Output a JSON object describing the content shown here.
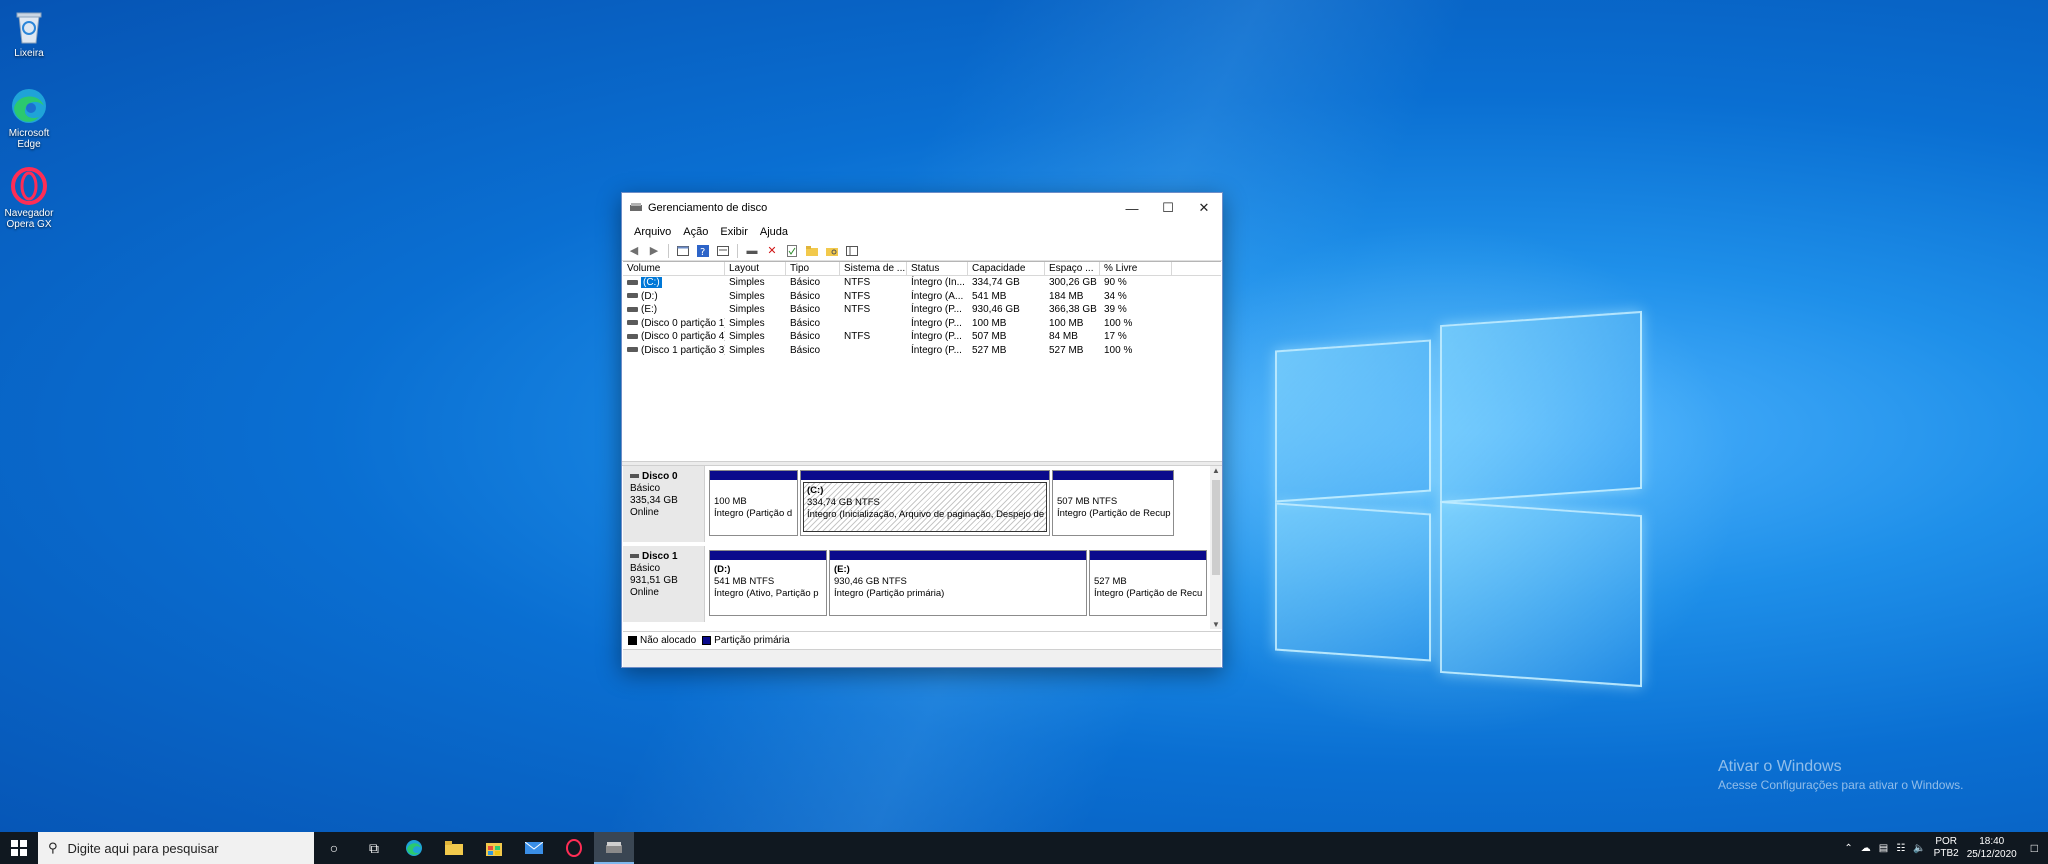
{
  "desktop": {
    "icons": [
      {
        "label": "Lixeira",
        "icon": "recycle-bin-icon"
      },
      {
        "label": "Microsoft Edge",
        "icon": "edge-icon"
      },
      {
        "label": "Navegador Opera GX",
        "icon": "opera-gx-icon"
      }
    ],
    "watermark": {
      "title": "Ativar o Windows",
      "subtitle": "Acesse Configurações para ativar o Windows."
    }
  },
  "window": {
    "title": "Gerenciamento de disco",
    "menu": [
      "Arquivo",
      "Ação",
      "Exibir",
      "Ajuda"
    ],
    "columns": [
      "Volume",
      "Layout",
      "Tipo",
      "Sistema de ...",
      "Status",
      "Capacidade",
      "Espaço ...",
      "% Livre"
    ],
    "rows": [
      [
        "(C:)",
        "Simples",
        "Básico",
        "NTFS",
        "Íntegro (In...",
        "334,74 GB",
        "300,26 GB",
        "90 %"
      ],
      [
        "(D:)",
        "Simples",
        "Básico",
        "NTFS",
        "Íntegro (A...",
        "541 MB",
        "184 MB",
        "34 %"
      ],
      [
        "(E:)",
        "Simples",
        "Básico",
        "NTFS",
        "Íntegro (P...",
        "930,46 GB",
        "366,38 GB",
        "39 %"
      ],
      [
        "(Disco 0 partição 1)",
        "Simples",
        "Básico",
        "",
        "Íntegro (P...",
        "100 MB",
        "100 MB",
        "100 %"
      ],
      [
        "(Disco 0 partição 4)",
        "Simples",
        "Básico",
        "NTFS",
        "Íntegro (P...",
        "507 MB",
        "84 MB",
        "17 %"
      ],
      [
        "(Disco 1 partição 3)",
        "Simples",
        "Básico",
        "",
        "Íntegro (P...",
        "527 MB",
        "527 MB",
        "100 %"
      ]
    ],
    "disks": [
      {
        "name": "Disco 0",
        "type": "Básico",
        "size": "335,34 GB",
        "state": "Online",
        "partitions": [
          {
            "title": "",
            "size": "100 MB",
            "status": "Íntegro (Partição d"
          },
          {
            "title": "(C:)",
            "size": "334,74 GB NTFS",
            "status": "Íntegro (Inicialização, Arquivo de paginação, Despejo de"
          },
          {
            "title": "",
            "size": "507 MB NTFS",
            "status": "Íntegro (Partição de Recup"
          }
        ]
      },
      {
        "name": "Disco 1",
        "type": "Básico",
        "size": "931,51 GB",
        "state": "Online",
        "partitions": [
          {
            "title": "(D:)",
            "size": "541 MB NTFS",
            "status": "Íntegro (Ativo, Partição p"
          },
          {
            "title": "(E:)",
            "size": "930,46 GB NTFS",
            "status": "Íntegro (Partição primária)"
          },
          {
            "title": "",
            "size": "527 MB",
            "status": "Íntegro (Partição de Recu"
          }
        ]
      }
    ],
    "legend": [
      {
        "label": "Não alocado",
        "color": "#000000"
      },
      {
        "label": "Partição primária",
        "color": "#0a0a8c"
      }
    ]
  },
  "taskbar": {
    "search_placeholder": "Digite aqui para pesquisar",
    "tray": {
      "lang": "POR",
      "layout": "PTB2",
      "time": "18:40",
      "date": "25/12/2020"
    }
  }
}
